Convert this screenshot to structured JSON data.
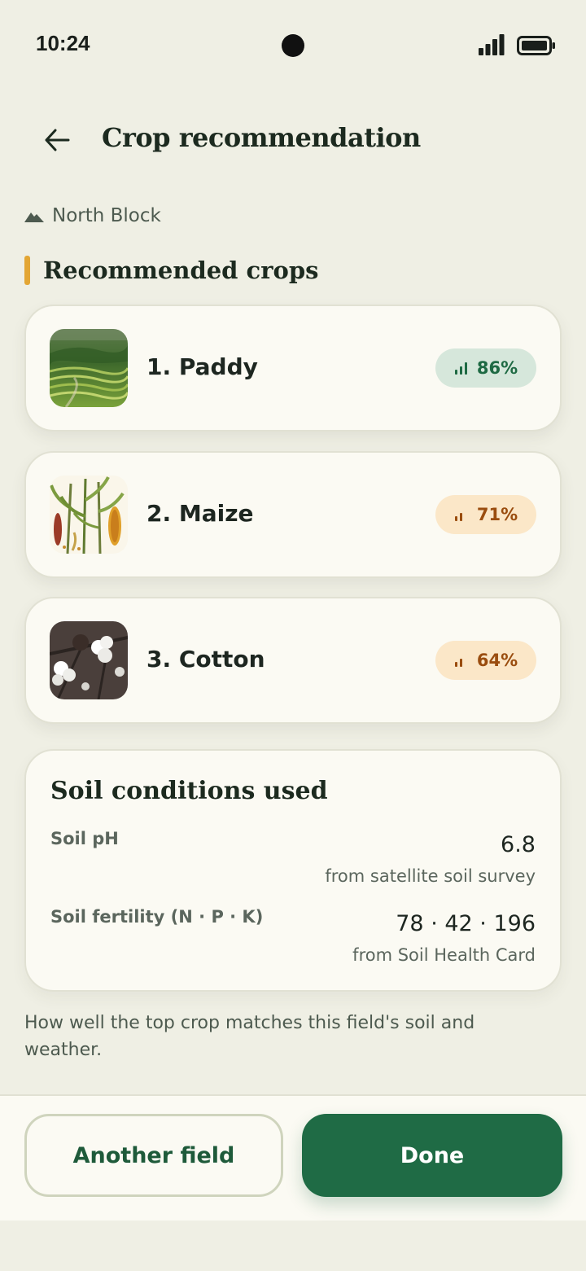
{
  "status_bar": {
    "time": "10:24"
  },
  "header": {
    "title": "Crop recommendation"
  },
  "field": {
    "name": "North Block"
  },
  "section": {
    "title": "Recommended crops"
  },
  "crops": [
    {
      "rank_name": "1. Paddy",
      "score": "86%",
      "level": "high"
    },
    {
      "rank_name": "2. Maize",
      "score": "71%",
      "level": "medium"
    },
    {
      "rank_name": "3. Cotton",
      "score": "64%",
      "level": "medium"
    }
  ],
  "soil": {
    "title": "Soil conditions used",
    "ph": {
      "label": "Soil pH",
      "value": "6.8",
      "source": "from satellite soil survey"
    },
    "fertility": {
      "label": "Soil fertility (N · P · K)",
      "value": "78 · 42 · 196",
      "source": "from Soil Health Card"
    }
  },
  "footnote": "How well the top crop matches this field's soil and weather.",
  "actions": {
    "secondary": "Another field",
    "primary": "Done"
  },
  "colors": {
    "primary": "#1f6b45",
    "accent": "#e3a634",
    "score_high_bg": "#d6e7db",
    "score_mid_bg": "#fbe7c8"
  }
}
